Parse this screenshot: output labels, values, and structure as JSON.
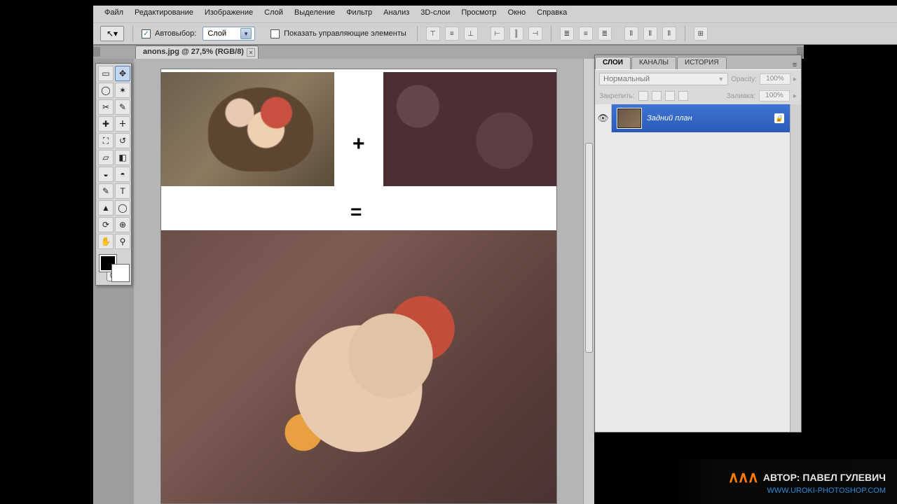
{
  "menu": {
    "file": "Файл",
    "edit": "Редактирование",
    "image": "Изображение",
    "layer": "Слой",
    "select": "Выделение",
    "filter": "Фильтр",
    "analysis": "Анализ",
    "threeD": "3D-слои",
    "view": "Просмотр",
    "window": "Окно",
    "help": "Справка"
  },
  "options": {
    "auto_select_label": "Автовыбор:",
    "auto_select_value": "Слой",
    "show_transform_label": "Показать управляющие элементы",
    "auto_select_checked": "✓"
  },
  "document": {
    "tab_label": "anons.jpg @ 27,5% (RGB/8)"
  },
  "panels": {
    "tabs": {
      "layers": "СЛОИ",
      "channels": "КАНАЛЫ",
      "history": "ИСТОРИЯ"
    },
    "blend_mode": "Нормальный",
    "opacity_label": "Opacity:",
    "opacity_value": "100%",
    "lock_label": "Закрепить:",
    "fill_label": "Заливка:",
    "fill_value": "100%",
    "layer0_name": "Задний план"
  },
  "watermark": {
    "author_prefix": "АВТОР:",
    "author_name": "ПАВЕЛ ГУЛЕВИЧ",
    "url": "WWW.UROKI-PHOTOSHOP.COM"
  },
  "tool_icons": [
    "▭",
    "↖",
    "◯",
    "✂",
    "✥",
    "✎",
    "⌫",
    "▰",
    "⚲",
    "◧",
    "◐",
    "◑",
    "⟋",
    "T",
    "△",
    "◯",
    "✋",
    "⚲"
  ]
}
